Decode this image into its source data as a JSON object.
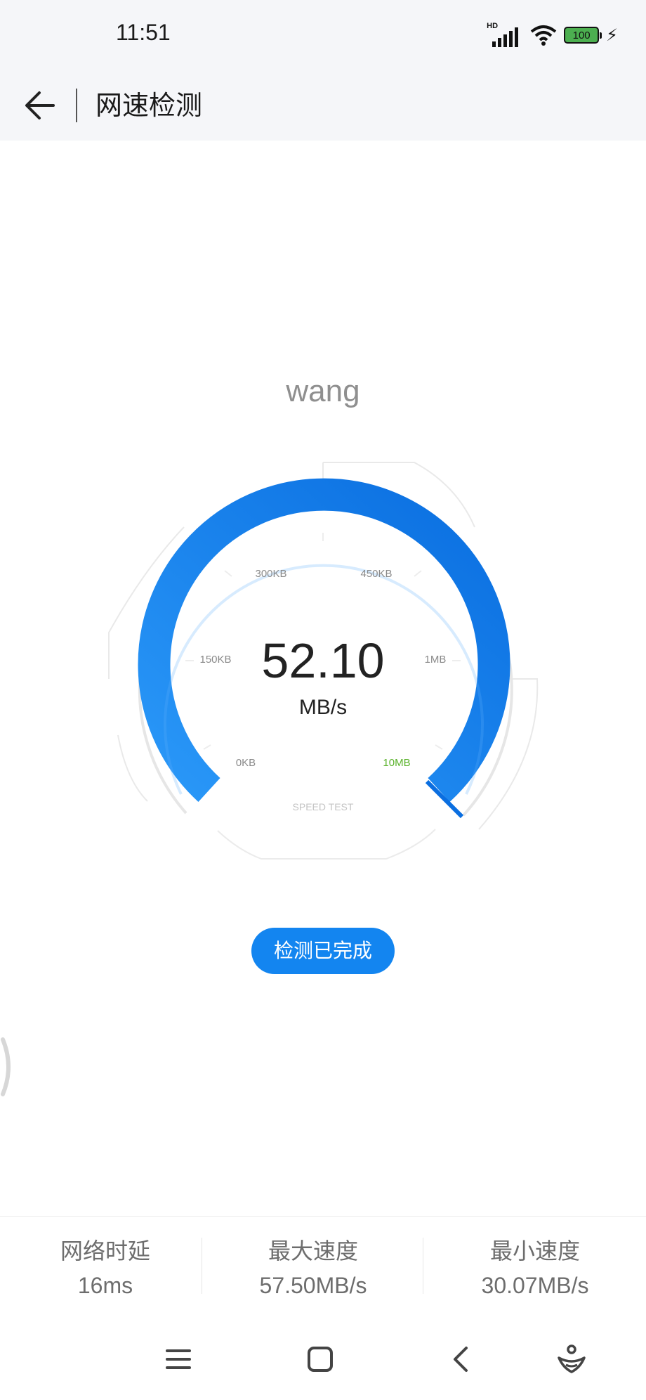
{
  "status_bar": {
    "time": "11:51",
    "signal_badge": "HD",
    "battery": "100",
    "icons": [
      "signal-icon",
      "wifi-icon",
      "battery-icon",
      "charging-icon"
    ]
  },
  "header": {
    "title": "网速检测",
    "back_icon": "back-arrow-icon"
  },
  "network": {
    "name": "wang"
  },
  "gauge": {
    "value": "52.10",
    "unit": "MB/s",
    "ticks": [
      "0KB",
      "150KB",
      "300KB",
      "450KB",
      "1MB",
      "10MB"
    ],
    "footer": "SPEED TEST",
    "fill_fraction": 1.0,
    "colors": {
      "arc_start": "#2a96f7",
      "arc_end": "#0a6fe0",
      "track": "#e8e8e8",
      "max_tick": "#5ab22b"
    }
  },
  "status_button": {
    "label": "检测已完成",
    "color": "#1385f0"
  },
  "stats": [
    {
      "label": "网络时延",
      "value": "16ms"
    },
    {
      "label": "最大速度",
      "value": "57.50MB/s"
    },
    {
      "label": "最小速度",
      "value": "30.07MB/s"
    }
  ],
  "nav_bar": {
    "icons": [
      "menu-icon",
      "home-icon",
      "back-icon",
      "assistant-icon"
    ]
  }
}
